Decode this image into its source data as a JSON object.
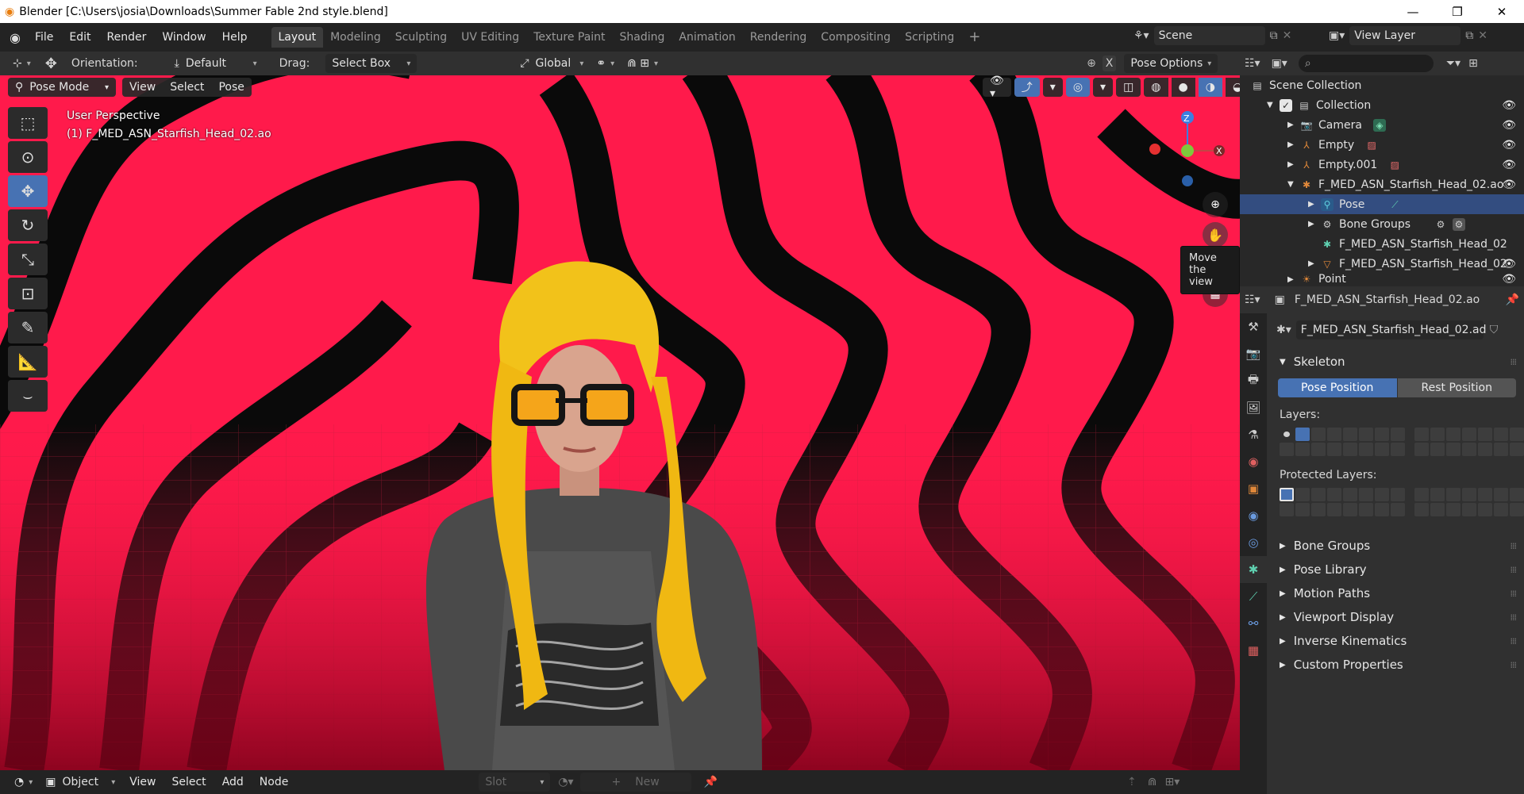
{
  "window": {
    "title": "Blender [C:\\Users\\josia\\Downloads\\Summer Fable 2nd style.blend]",
    "min": "—",
    "max": "❐",
    "close": "✕"
  },
  "menu": [
    "File",
    "Edit",
    "Render",
    "Window",
    "Help"
  ],
  "workspaces": [
    "Layout",
    "Modeling",
    "Sculpting",
    "UV Editing",
    "Texture Paint",
    "Shading",
    "Animation",
    "Rendering",
    "Compositing",
    "Scripting"
  ],
  "active_workspace": "Layout",
  "add_workspace": "+",
  "scene": "Scene",
  "view_layer": "View Layer",
  "toolheader": {
    "orientation_label": "Orientation:",
    "orientation_value": "Default",
    "drag_label": "Drag:",
    "drag_value": "Select Box",
    "transform_orientation": "Global",
    "pose_options": "Pose Options",
    "x_label": "X"
  },
  "viewport": {
    "mode": "Pose Mode",
    "menus": [
      "View",
      "Select",
      "Pose"
    ],
    "perspective": "User Perspective",
    "object_label": "(1) F_MED_ASN_Starfish_Head_02.ao",
    "tooltip": "Move the view",
    "gizmo": {
      "z": "Z",
      "x": "X"
    }
  },
  "bottom": {
    "editor": "Object",
    "menus": [
      "View",
      "Select",
      "Add",
      "Node"
    ],
    "slot": "Slot",
    "new": "New"
  },
  "outliner": {
    "rows": [
      {
        "label": "Scene Collection",
        "indent": 0
      },
      {
        "label": "Collection",
        "indent": 1
      },
      {
        "label": "Camera",
        "indent": 2
      },
      {
        "label": "Empty",
        "indent": 2
      },
      {
        "label": "Empty.001",
        "indent": 2
      },
      {
        "label": "F_MED_ASN_Starfish_Head_02.ao",
        "indent": 2
      },
      {
        "label": "Pose",
        "indent": 3
      },
      {
        "label": "Bone Groups",
        "indent": 3
      },
      {
        "label": "F_MED_ASN_Starfish_Head_02",
        "indent": 3
      },
      {
        "label": "F_MED_ASN_Starfish_Head_02",
        "indent": 3
      },
      {
        "label": "Point",
        "indent": 2
      }
    ]
  },
  "properties": {
    "object_name": "F_MED_ASN_Starfish_Head_02.ao",
    "data_name": "F_MED_ASN_Starfish_Head_02.ad",
    "skeleton": "Skeleton",
    "pose_position": "Pose Position",
    "rest_position": "Rest Position",
    "layers_label": "Layers:",
    "protected_layers_label": "Protected Layers:",
    "panels": [
      "Bone Groups",
      "Pose Library",
      "Motion Paths",
      "Viewport Display",
      "Inverse Kinematics",
      "Custom Properties"
    ]
  },
  "colors": {
    "accent": "#4772b3",
    "background_red": "#ff1a4b",
    "hair": "#f2c21a"
  }
}
